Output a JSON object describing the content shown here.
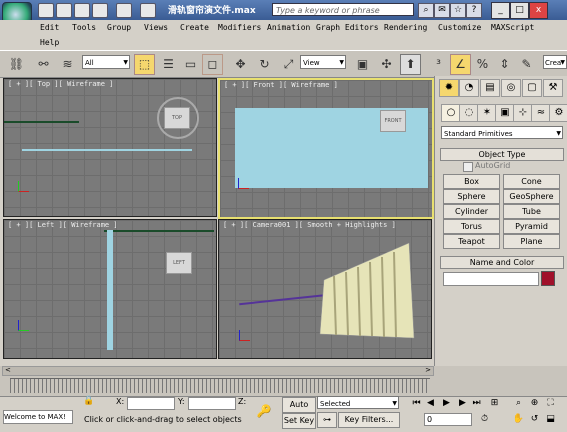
{
  "title": {
    "doc_title": "滑轨窗帘演文件.max",
    "search_placeholder": "Type a keyword or phrase",
    "minimize": "_",
    "maximize": "□",
    "close": "x",
    "help_btn": "?"
  },
  "menu": [
    "Edit",
    "Tools",
    "Group",
    "Views",
    "Create",
    "Modifiers",
    "Animation",
    "Graph Editors",
    "Rendering",
    "Customize",
    "MAXScript",
    "Help"
  ],
  "toolbar": {
    "selection_filter": "All",
    "ref_coord": "View",
    "search_box": "Crea"
  },
  "viewports": {
    "top": {
      "label": "[ + ][ Top ][ Wireframe ]",
      "cube": "TOP"
    },
    "front": {
      "label": "[ + ][ Front ][ Wireframe ]",
      "cube": "FRONT"
    },
    "left": {
      "label": "[ + ][ Left ][ Wireframe ]",
      "cube": "LEFT"
    },
    "camera": {
      "label": "[ + ][ Camera001 ][ Smooth + Highlights ]"
    }
  },
  "command_panel": {
    "category": "Standard Primitives",
    "object_type_title": "Object Type",
    "autogrid_label": "AutoGrid",
    "buttons": [
      "Box",
      "Cone",
      "Sphere",
      "GeoSphere",
      "Cylinder",
      "Tube",
      "Torus",
      "Pyramid",
      "Teapot",
      "Plane"
    ],
    "name_color_title": "Name and Color",
    "object_color": "#a0102a"
  },
  "timeline": {
    "frame_label": "0 / 100",
    "nav_left": "<",
    "nav_right": ">"
  },
  "status": {
    "welcome": "Welcome to MAX!",
    "prompt": "Click or click-and-drag to select objects",
    "x_label": "X:",
    "y_label": "Y:",
    "z_label": "Z:",
    "auto_key": "Auto Key",
    "set_key": "Set Key",
    "key_mode": "Selected",
    "key_filters": "Key Filters...",
    "frame_value": "0"
  },
  "colors": {
    "active_border": "#e8e070",
    "curtain_blue": "#9fd4e2"
  }
}
